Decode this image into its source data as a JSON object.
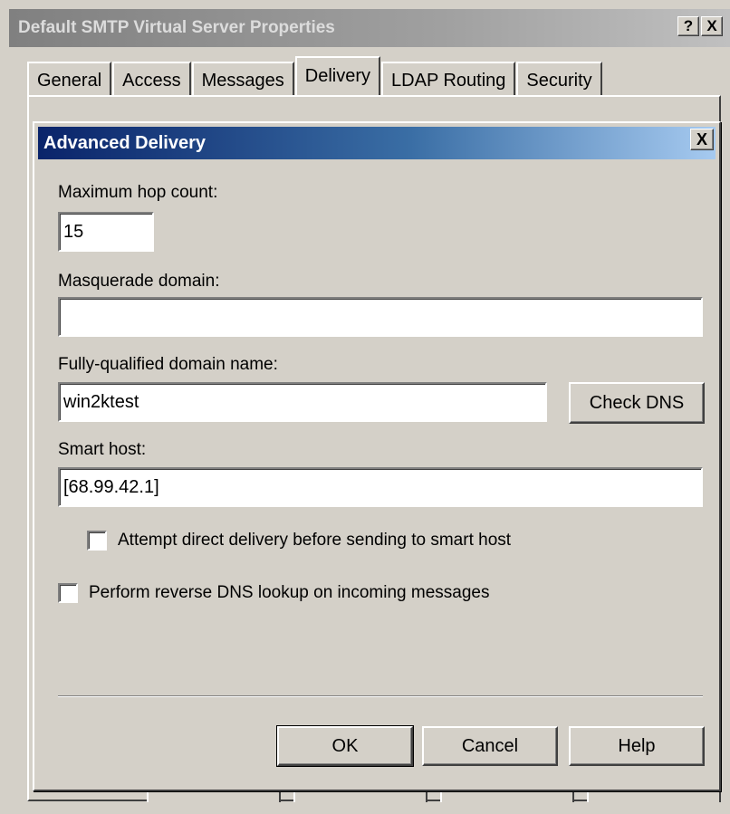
{
  "outer_dialog": {
    "title": "Default SMTP Virtual Server Properties",
    "help_glyph": "?",
    "close_glyph": "X",
    "tabs": [
      {
        "label": "General"
      },
      {
        "label": "Access"
      },
      {
        "label": "Messages"
      },
      {
        "label": "Delivery",
        "active": true
      },
      {
        "label": "LDAP Routing"
      },
      {
        "label": "Security"
      }
    ]
  },
  "advanced_delivery": {
    "title": "Advanced Delivery",
    "close_glyph": "X",
    "max_hop_count": {
      "label": "Maximum hop count:",
      "value": "15"
    },
    "masquerade_domain": {
      "label": "Masquerade domain:",
      "value": ""
    },
    "fqdn": {
      "label": "Fully-qualified domain name:",
      "value": "win2ktest",
      "check_dns_label": "Check DNS"
    },
    "smart_host": {
      "label": "Smart host:",
      "value": "[68.99.42.1]"
    },
    "attempt_direct": {
      "label": "Attempt direct delivery before sending to smart host",
      "checked": false
    },
    "reverse_dns": {
      "label": "Perform reverse DNS lookup on incoming messages",
      "checked": false
    },
    "buttons": {
      "ok": "OK",
      "cancel": "Cancel",
      "help": "Help"
    }
  },
  "colors": {
    "face": "#d4d0c8",
    "active_title": "#0a246a",
    "inactive_title": "#808080"
  }
}
